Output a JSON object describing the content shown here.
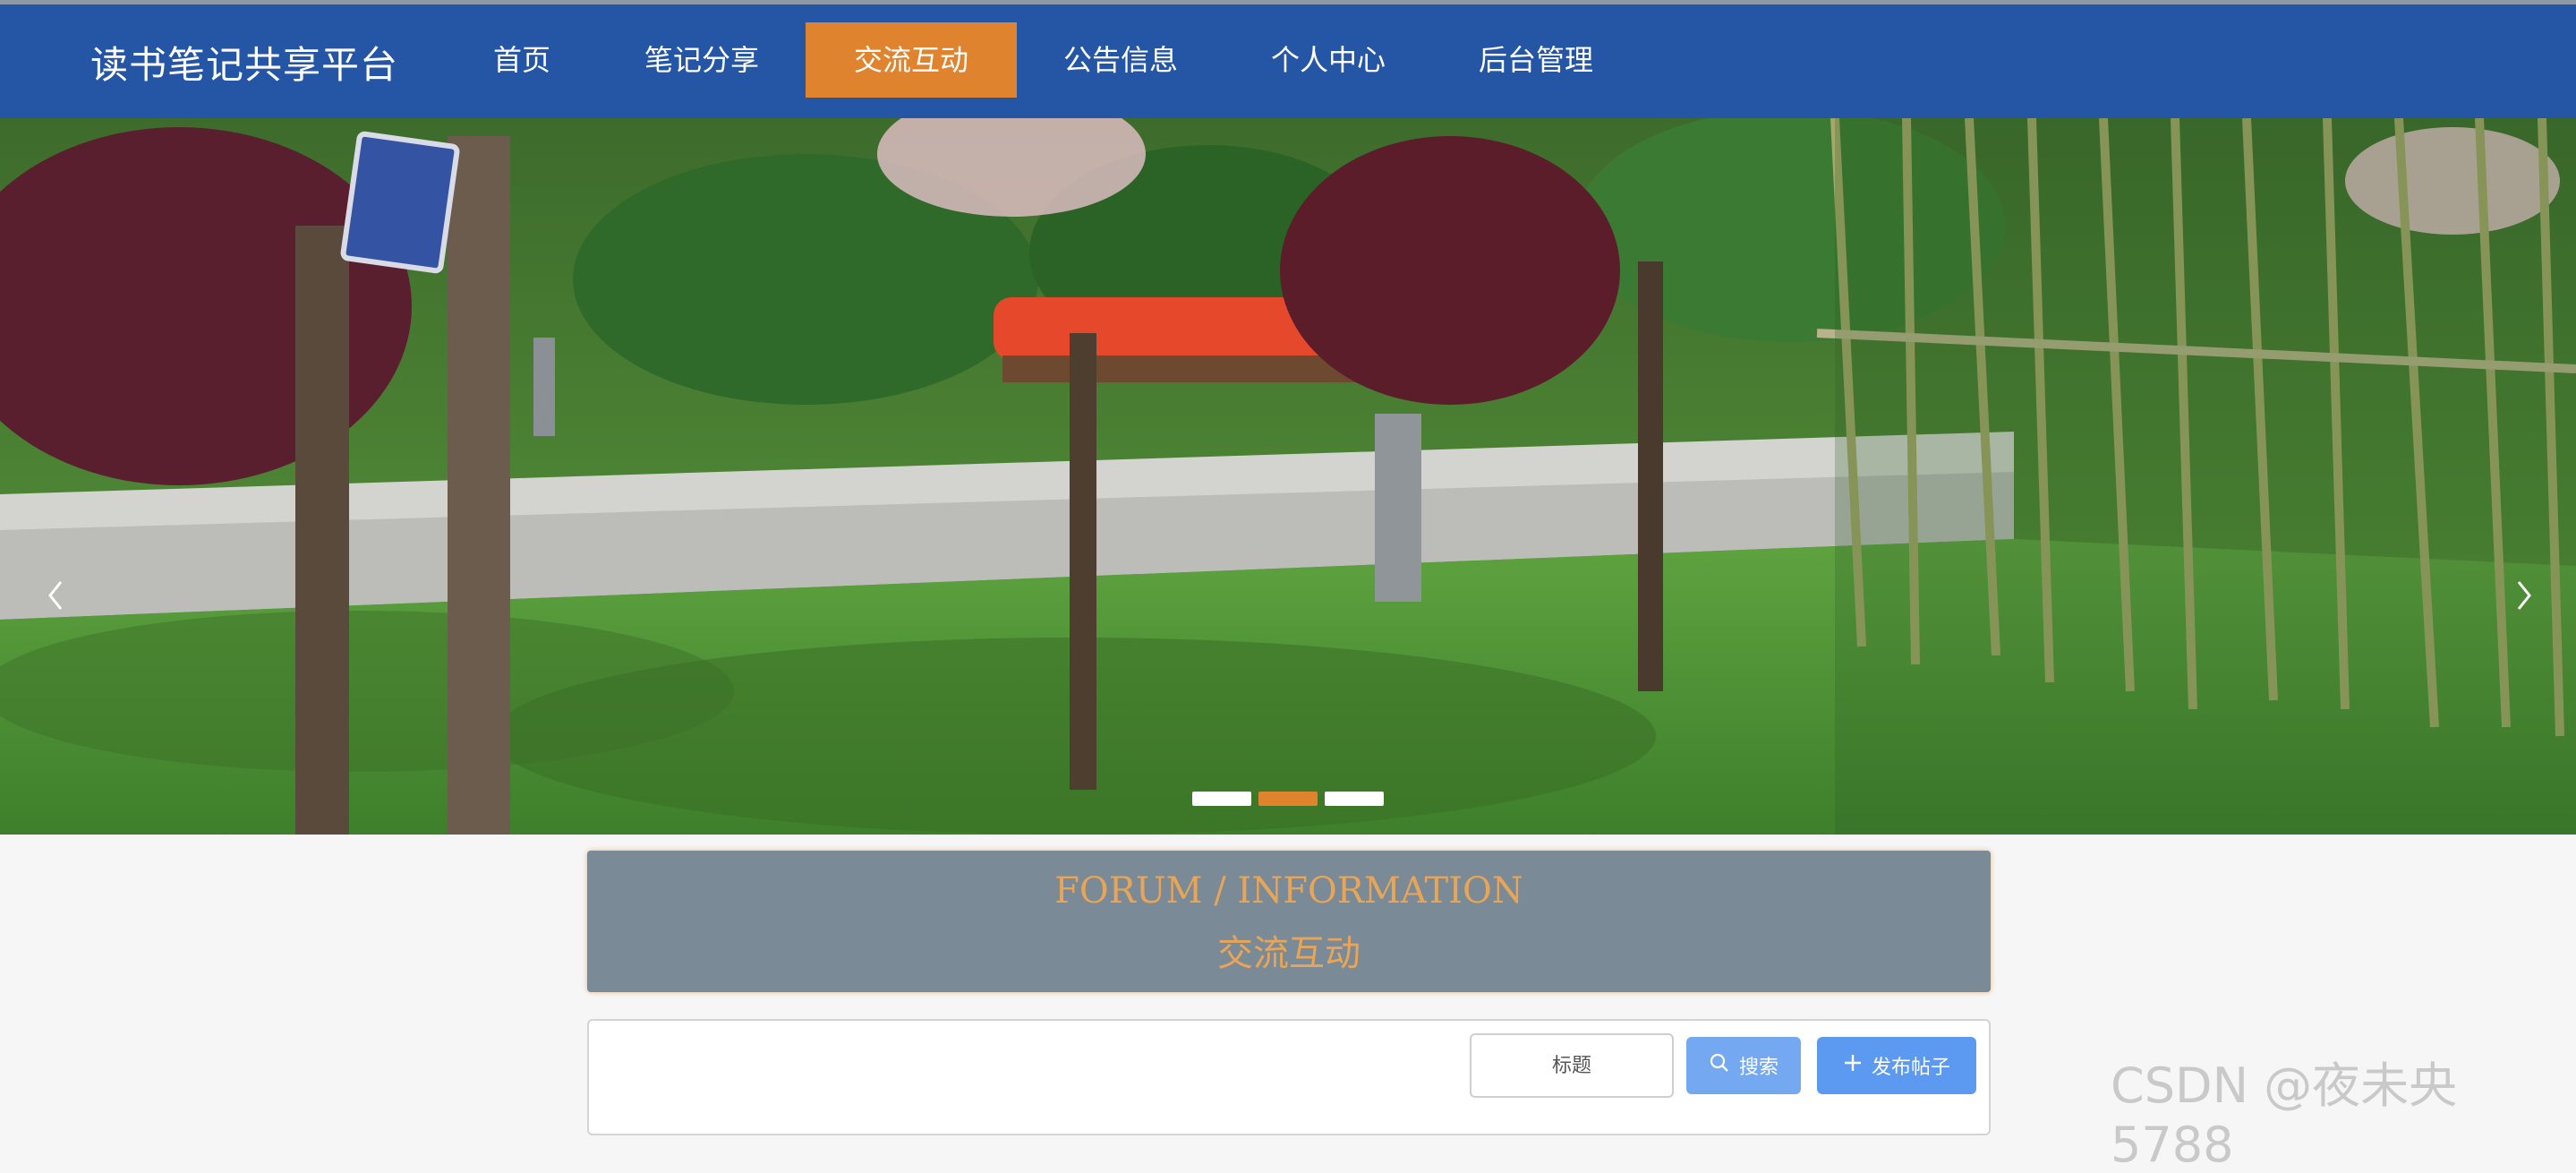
{
  "brand": "读书笔记共享平台",
  "nav": [
    {
      "label": "首页"
    },
    {
      "label": "笔记分享"
    },
    {
      "label": "交流互动",
      "active": true
    },
    {
      "label": "公告信息"
    },
    {
      "label": "个人中心"
    },
    {
      "label": "后台管理"
    }
  ],
  "carousel": {
    "left_arrow": "‹",
    "right_arrow": "›",
    "slide_count": 3,
    "active_slide": 2
  },
  "section": {
    "title_en": "FORUM / INFORMATION",
    "title_cn": "交流互动"
  },
  "search": {
    "placeholder": "标题",
    "search_label": "搜索",
    "post_label": "发布帖子"
  },
  "watermark": "CSDN @夜未央5788",
  "colors": {
    "navbar": "#2556a6",
    "accent": "#e0832f",
    "section_bg": "#7a8a97",
    "section_text": "#e8a558",
    "button": "#5b9af0"
  },
  "icons": {
    "search": "magnifier-icon",
    "post": "plus-icon",
    "prev": "chevron-left-icon",
    "next": "chevron-right-icon"
  }
}
